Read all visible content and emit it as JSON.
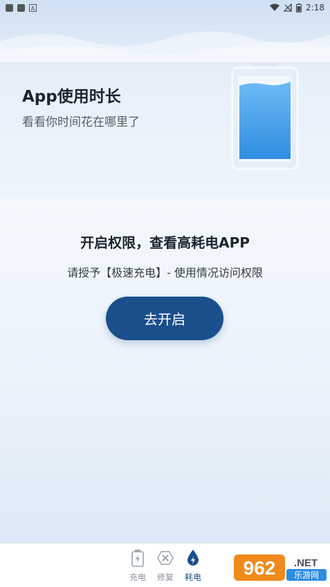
{
  "status_bar": {
    "time": "2:18"
  },
  "hero": {
    "title": "App使用时长",
    "subtitle": "看看你时间花在哪里了"
  },
  "permission": {
    "title": "开启权限，查看高耗电APP",
    "description": "请授予【极速充电】- 使用情况访问权限",
    "button_label": "去开启"
  },
  "tabbar": {
    "items": [
      {
        "label": "充电",
        "icon": "battery-charge-icon",
        "active": false
      },
      {
        "label": "修复",
        "icon": "repair-tools-icon",
        "active": false
      },
      {
        "label": "耗电",
        "icon": "power-drop-icon",
        "active": true
      }
    ]
  },
  "watermark": {
    "number": "962",
    "suffix": ".NET",
    "caption": "乐游网"
  },
  "colors": {
    "accent": "#1a4f8c",
    "battery_fill": "#3d9ae8"
  }
}
